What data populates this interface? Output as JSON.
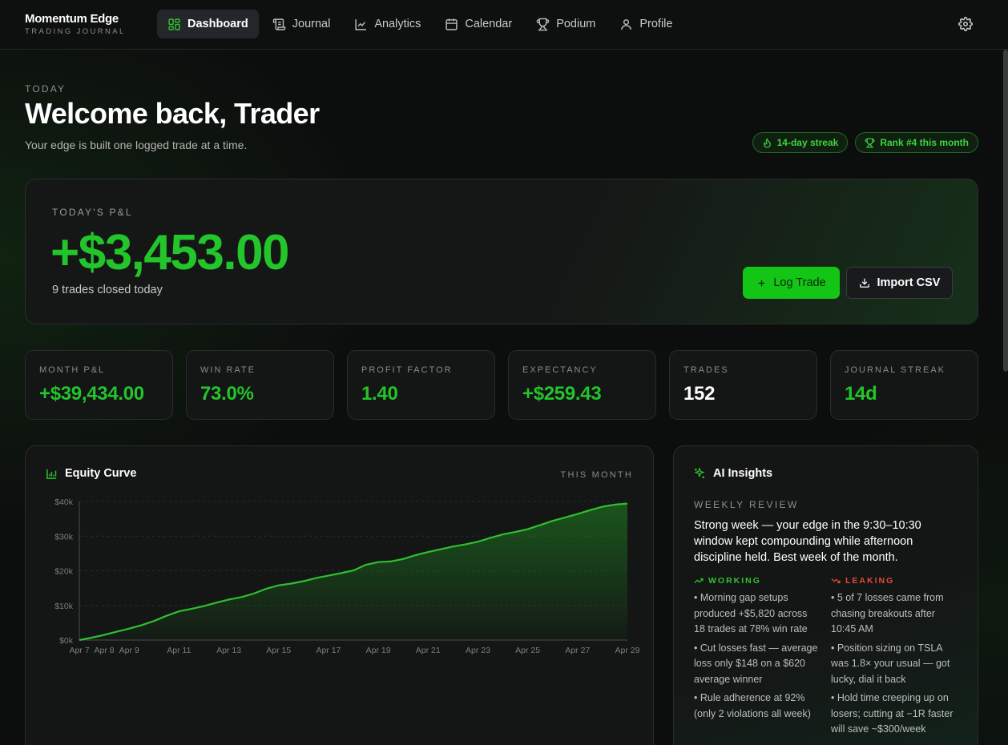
{
  "brand": {
    "name": "Momentum Edge",
    "subtitle": "TRADING JOURNAL"
  },
  "nav": {
    "items": [
      {
        "label": "Dashboard",
        "icon": "grid-icon",
        "active": true
      },
      {
        "label": "Journal",
        "icon": "scroll-icon"
      },
      {
        "label": "Analytics",
        "icon": "line-chart-icon"
      },
      {
        "label": "Calendar",
        "icon": "calendar-icon"
      },
      {
        "label": "Podium",
        "icon": "trophy-icon"
      },
      {
        "label": "Profile",
        "icon": "user-icon"
      }
    ],
    "settings_icon": "gear-icon"
  },
  "header": {
    "kicker": "TODAY",
    "title": "Welcome back, Trader",
    "tagline": "Your edge is built one logged trade at a time.",
    "badges": [
      {
        "label": "14-day streak",
        "icon": "flame-icon"
      },
      {
        "label": "Rank #4 this month",
        "icon": "trophy-icon"
      }
    ]
  },
  "pnl": {
    "label": "TODAY'S P&L",
    "value": "+$3,453.00",
    "sub": "9 trades closed today",
    "log_button": "Log Trade",
    "import_button": "Import CSV"
  },
  "stats": [
    {
      "label": "MONTH P&L",
      "value": "+$39,434.00",
      "color": "#22c52a"
    },
    {
      "label": "WIN RATE",
      "value": "73.0%",
      "color": "#22c52a"
    },
    {
      "label": "PROFIT FACTOR",
      "value": "1.40",
      "color": "#22c52a"
    },
    {
      "label": "EXPECTANCY",
      "value": "+$259.43",
      "color": "#22c52a"
    },
    {
      "label": "TRADES",
      "value": "152",
      "color": "#ffffff"
    },
    {
      "label": "JOURNAL STREAK",
      "value": "14d",
      "color": "#22c52a"
    }
  ],
  "equity": {
    "title": "Equity Curve",
    "period": "THIS MONTH"
  },
  "chart_data": {
    "type": "area",
    "title": "Equity Curve",
    "y_ticks": [
      "$0k",
      "$10k",
      "$20k",
      "$30k",
      "$40k"
    ],
    "ylim": [
      0,
      40000
    ],
    "x_tick_labels": [
      "Apr 7",
      "Apr 8",
      "Apr 9",
      "Apr 11",
      "Apr 13",
      "Apr 15",
      "Apr 17",
      "Apr 19",
      "Apr 21",
      "Apr 23",
      "Apr 25",
      "Apr 27",
      "Apr 29"
    ],
    "x_tick_days": [
      7,
      8,
      9,
      11,
      13,
      15,
      17,
      19,
      21,
      23,
      25,
      27,
      29
    ],
    "series": [
      {
        "days": [
          7,
          7.5,
          8,
          8.5,
          9,
          9.5,
          10,
          10.5,
          11,
          11.5,
          12,
          12.5,
          13,
          13.5,
          14,
          14.5,
          15,
          15.5,
          16,
          16.5,
          17,
          17.5,
          18,
          18.5,
          19,
          19.5,
          20,
          20.5,
          21,
          21.5,
          22,
          22.5,
          23,
          23.5,
          24,
          24.5,
          25,
          25.5,
          26,
          26.5,
          27,
          27.5,
          28,
          28.5,
          29
        ],
        "values": [
          0,
          700,
          1500,
          2400,
          3300,
          4300,
          5500,
          7000,
          8300,
          9000,
          9800,
          10800,
          11700,
          12400,
          13400,
          14800,
          15800,
          16300,
          17000,
          17900,
          18600,
          19300,
          20100,
          21700,
          22500,
          22700,
          23400,
          24500,
          25400,
          26200,
          27000,
          27600,
          28400,
          29500,
          30500,
          31200,
          32000,
          33200,
          34400,
          35400,
          36400,
          37500,
          38500,
          39100,
          39400
        ],
        "color": "#2fbf2f"
      }
    ]
  },
  "ai": {
    "title": "AI Insights",
    "kicker": "WEEKLY REVIEW",
    "summary": "Strong week — your edge in the 9:30–10:30 window kept compounding while afternoon discipline held. Best week of the month.",
    "working": {
      "label": "WORKING",
      "color": "#2fc22f",
      "items": [
        "• Morning gap setups produced +$5,820 across 18 trades at 78% win rate",
        "• Cut losses fast — average loss only $148 on a $620 average winner",
        "• Rule adherence at 92% (only 2 violations all week)"
      ]
    },
    "leaking": {
      "label": "LEAKING",
      "color": "#e24a3a",
      "items": [
        "• 5 of 7 losses came from chasing breakouts after 10:45 AM",
        "• Position sizing on TSLA was 1.8× your usual — got lucky, dial it back",
        "• Hold time creeping up on losers; cutting at −1R faster will save ~$300/week"
      ]
    }
  }
}
